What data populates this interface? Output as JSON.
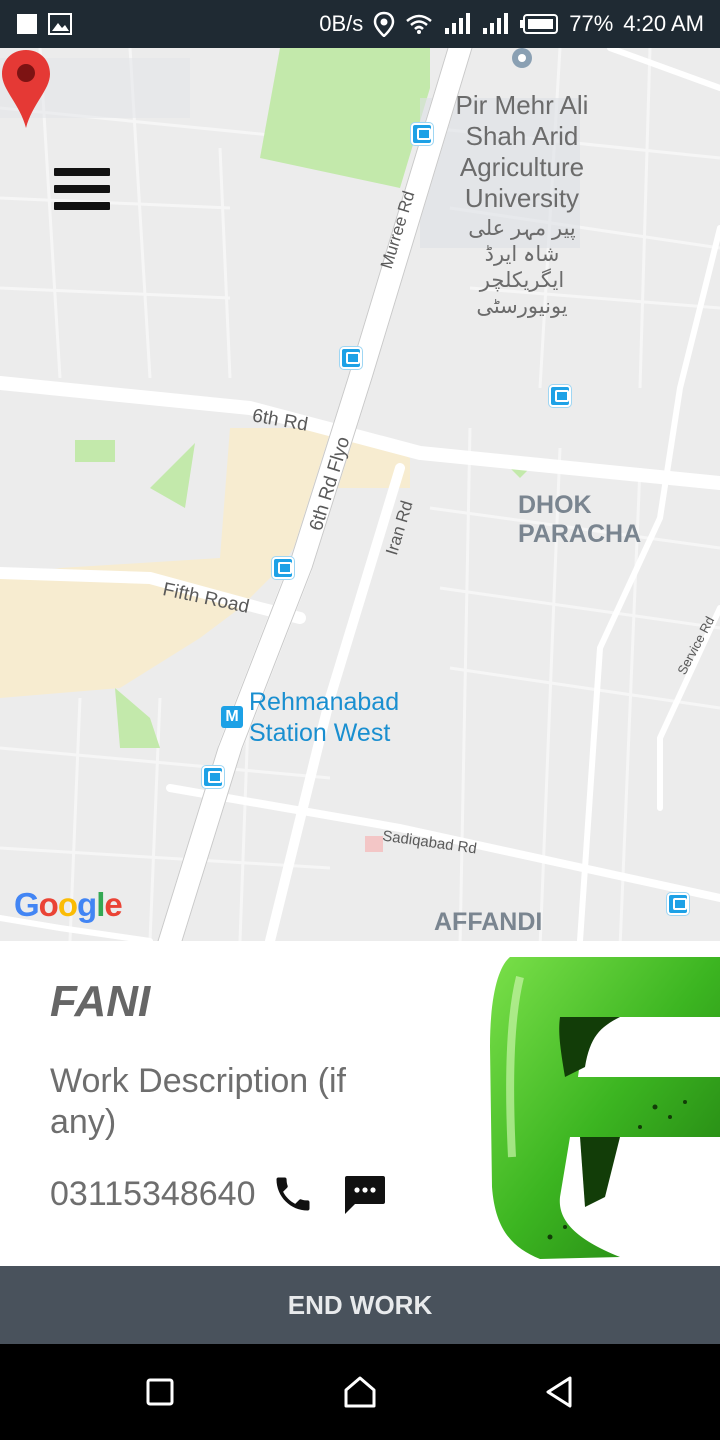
{
  "status_bar": {
    "network_speed": "0B/s",
    "battery": "77%",
    "time": "4:20 AM",
    "icons": [
      "notification-square-icon",
      "image-icon",
      "location-icon",
      "wifi-icon",
      "signal-icon",
      "signal-icon",
      "battery-icon"
    ]
  },
  "map": {
    "roads": {
      "murree_rd": "Murree Rd",
      "sixth_rd": "6th Rd",
      "sixth_rd_flyover": "6th Rd Flyo",
      "iran_rd": "Iran Rd",
      "fifth_road": "Fifth Road",
      "sadiqabad_rd": "Sadiqabad Rd",
      "service_rd": "Service Rd"
    },
    "poi": {
      "university_en": "Pir Mehr Ali Shah Arid Agriculture University",
      "university_ur": "پیر مہر علی شاہ ایرڈ ایگریکلچر یونیورسٹی",
      "station": "Rehmanabad Station West"
    },
    "districts": {
      "dhok_paracha": "DHOK PARACHA",
      "affandi": "AFFANDI"
    },
    "attribution": "Google",
    "menu_icon": "hamburger-menu-icon",
    "marker_icon": "map-pin-icon"
  },
  "worker": {
    "name": "FANI",
    "description": "Work Description (if any)",
    "phone": "03115348640",
    "call_icon": "phone-icon",
    "message_icon": "sms-icon"
  },
  "actions": {
    "end_work": "END WORK"
  },
  "colors": {
    "status_bar": "#1f2a33",
    "button": "#49525c",
    "marker": "#e53935",
    "transit": "#1a8fd0",
    "logo_green": "#3cb521"
  },
  "nav_bar": {
    "icons": [
      "recent-apps-icon",
      "home-icon",
      "back-icon"
    ]
  }
}
